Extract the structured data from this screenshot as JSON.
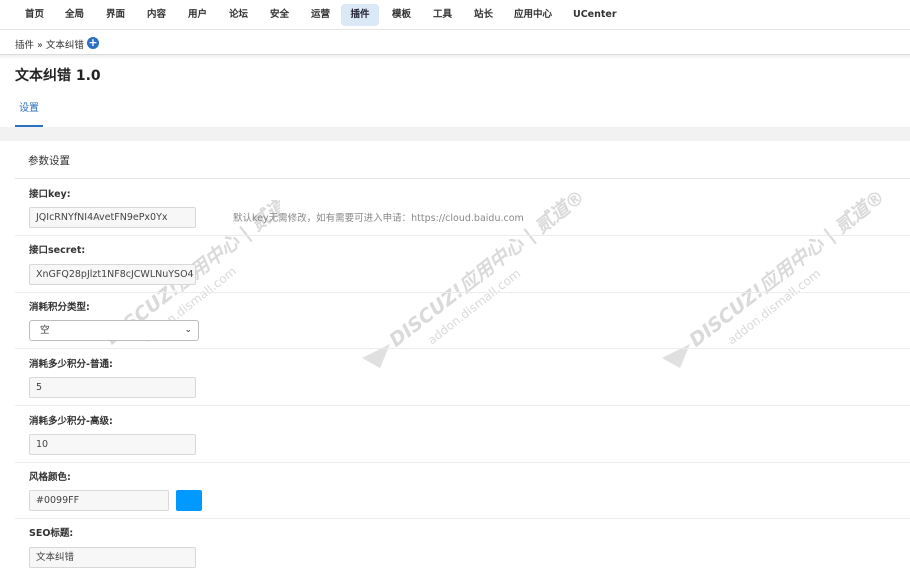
{
  "nav": {
    "items": [
      "首页",
      "全局",
      "界面",
      "内容",
      "用户",
      "论坛",
      "安全",
      "运营",
      "插件",
      "模板",
      "工具",
      "站长",
      "应用中心",
      "UCenter"
    ],
    "active": "插件"
  },
  "breadcrumb": {
    "text": "插件 » 文本纠错"
  },
  "page": {
    "title": "文本纠错 1.0"
  },
  "tabs": {
    "settings": "设置"
  },
  "section": {
    "title": "参数设置"
  },
  "fields": {
    "key_label": "接口key:",
    "key_value": "JQIcRNYfNI4AvetFN9ePx0Yx",
    "key_help": "默认key无需修改，如有需要可进入申请：https://cloud.baidu.com",
    "secret_label": "接口secret:",
    "secret_value": "XnGFQ28pJlzt1NF8cJCWLNuYSO4",
    "credit_type_label": "消耗积分类型:",
    "credit_type_value": "空",
    "normal_label": "消耗多少积分-普通:",
    "normal_value": "5",
    "advanced_label": "消耗多少积分-高级:",
    "advanced_value": "10",
    "color_label": "风格颜色:",
    "color_value": "#0099FF",
    "seo_label": "SEO标题:",
    "seo_value": "文本纠错"
  },
  "watermark": {
    "line1": "DISCUZ!应用中心 | 贰道®",
    "line2": "addon.dismall.com"
  },
  "colors": {
    "accent": "#2b6fc0",
    "swatch": "#0099FF",
    "nav_active_bg": "#dbe8f6"
  }
}
